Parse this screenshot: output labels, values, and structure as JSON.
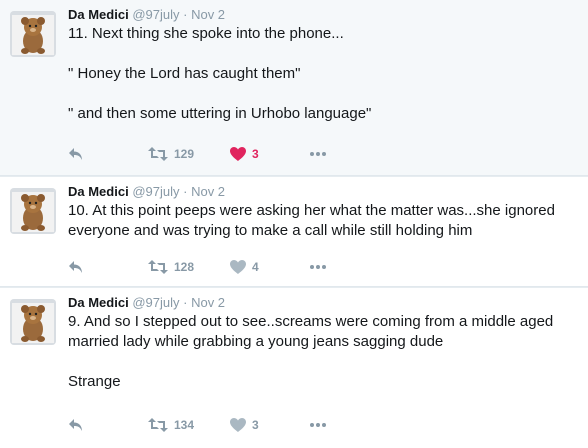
{
  "tweets": [
    {
      "name": "Da Medici",
      "handle": "@97july",
      "separator": "·",
      "time": "Nov 2",
      "text": "11. Next thing she spoke into the phone...\n\n\" Honey the Lord has caught them\"\n\n\" and then some uttering in Urhobo language\"",
      "retweets": "129",
      "likes": "3",
      "liked": true
    },
    {
      "name": "Da Medici",
      "handle": "@97july",
      "separator": "·",
      "time": "Nov 2",
      "text": "10. At this point peeps were asking her what the matter was...she ignored everyone and was trying to make a call while still holding him",
      "retweets": "128",
      "likes": "4",
      "liked": false
    },
    {
      "name": "Da Medici",
      "handle": "@97july",
      "separator": "·",
      "time": "Nov 2",
      "text": "9. And so I stepped out to see..screams were coming from a middle aged married lady while grabbing a young jeans sagging dude\n\nStrange",
      "retweets": "134",
      "likes": "3",
      "liked": false
    }
  ],
  "icons": {
    "reply": "reply-icon",
    "retweet": "retweet-icon",
    "like": "heart-icon",
    "more": "more-icon"
  },
  "colors": {
    "muted": "#8899a6",
    "like_active": "#e0245e",
    "highlight_bg": "#f5f8fa"
  }
}
